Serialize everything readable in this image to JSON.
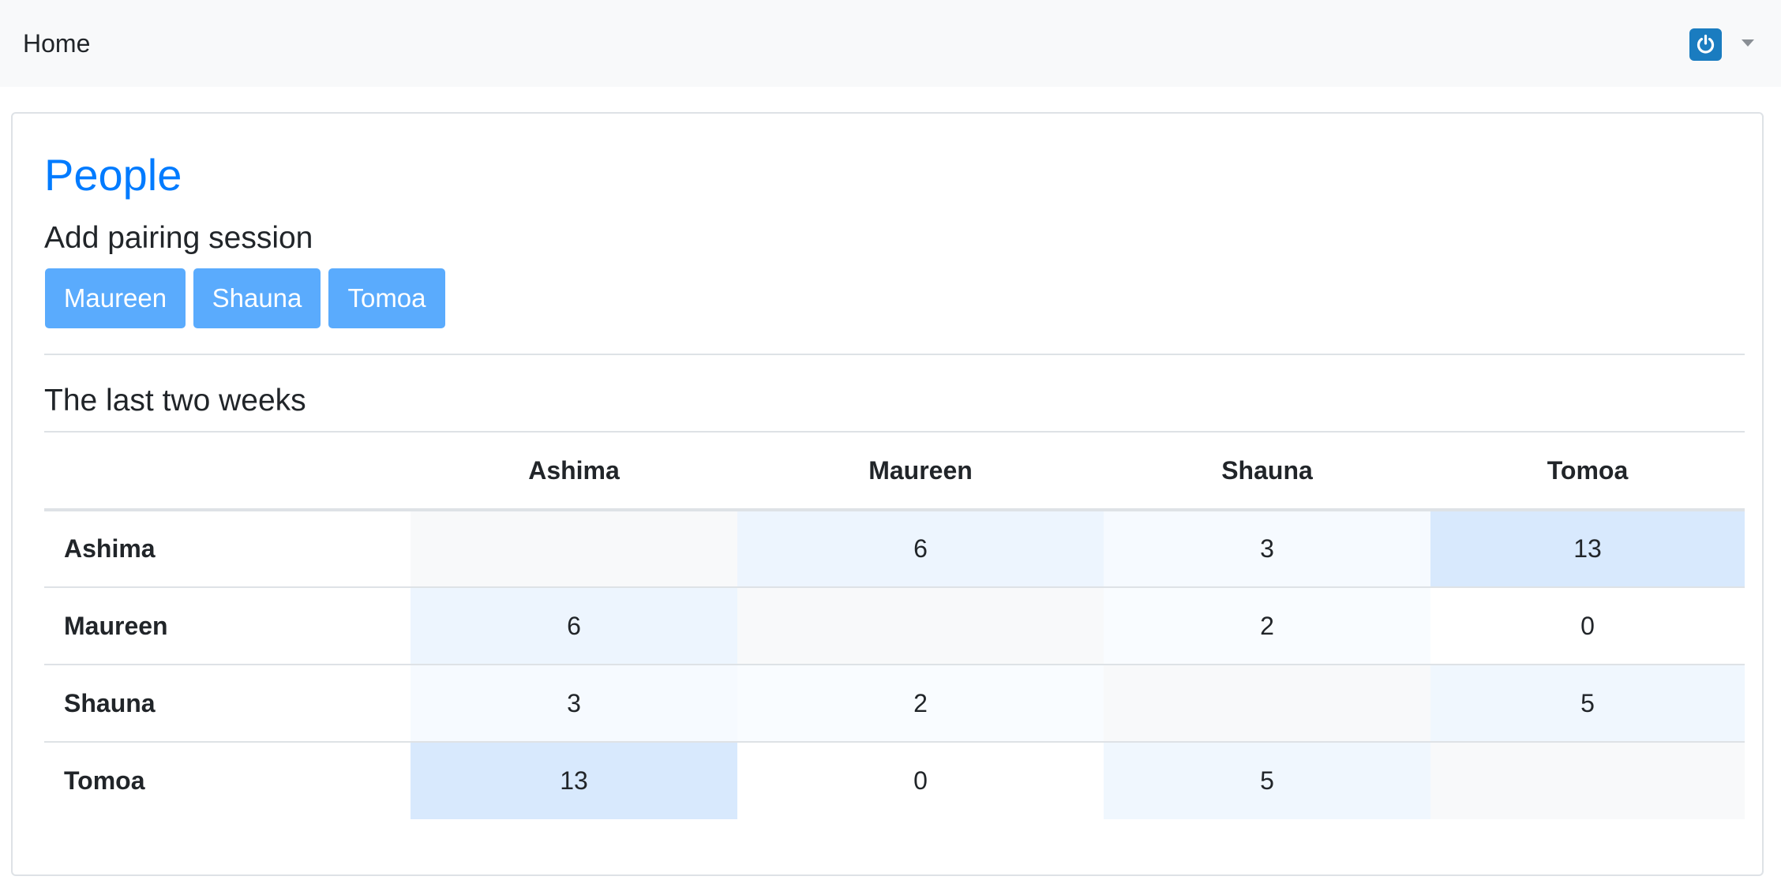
{
  "navbar": {
    "home_label": "Home",
    "user_icon": "power-icon",
    "menu_icon": "caret-down-icon"
  },
  "colors": {
    "accent": "#007bff",
    "button": "#5aabfd",
    "nav_bg": "#f8f9fa",
    "diagonal_cell": "#f8f9fa",
    "heat_low": "#ffffff",
    "heat_high": "#d8e9fd"
  },
  "page": {
    "title": "People",
    "add_section_title": "Add pairing session",
    "people_buttons": [
      "Maureen",
      "Shauna",
      "Tomoa"
    ],
    "history_title": "The last two weeks"
  },
  "matrix": {
    "corner": "",
    "columns": [
      "Ashima",
      "Maureen",
      "Shauna",
      "Tomoa"
    ],
    "rows": [
      {
        "name": "Ashima",
        "cells": [
          "",
          "6",
          "3",
          "13"
        ]
      },
      {
        "name": "Maureen",
        "cells": [
          "6",
          "",
          "2",
          "0"
        ]
      },
      {
        "name": "Shauna",
        "cells": [
          "3",
          "2",
          "",
          "5"
        ]
      },
      {
        "name": "Tomoa",
        "cells": [
          "13",
          "0",
          "5",
          ""
        ]
      }
    ],
    "max_value": 13
  }
}
